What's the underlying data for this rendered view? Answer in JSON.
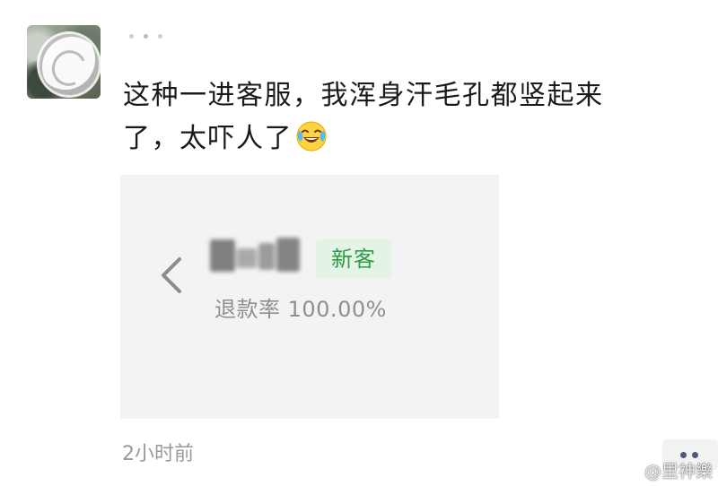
{
  "post": {
    "text_line1": "这种一进客服，我浑身汗毛孔都竖起来",
    "text_line2": "了，太吓人了",
    "emoji": "laughing-crying-emoji",
    "timestamp": "2小时前"
  },
  "screenshot": {
    "badge": "新客",
    "refund_rate": "退款率 100.00%",
    "badge_colors": {
      "text": "#2f9c47",
      "background": "#e5f3e6"
    }
  },
  "watermark": {
    "text": "@里神樂"
  },
  "icons": {
    "back": "chevron-left-icon",
    "more": "more-dots-icon",
    "watermark": "weibo-icon"
  }
}
